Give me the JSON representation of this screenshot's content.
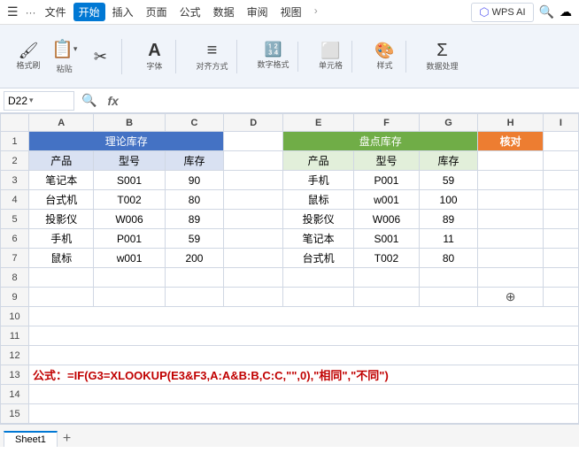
{
  "titlebar": {
    "menus": [
      "文件",
      "开始",
      "插入",
      "页面",
      "公式",
      "数据",
      "审阅",
      "视图"
    ],
    "active_menu": "开始",
    "wps_ai": "WPS AI",
    "dots": "···"
  },
  "ribbon": {
    "groups": [
      {
        "name": "clipboard",
        "items": [
          {
            "label": "格式刷",
            "icon": "🖌"
          },
          {
            "label": "粘贴",
            "icon": "📋"
          },
          {
            "label": "",
            "icon": "✂"
          }
        ]
      },
      {
        "name": "font",
        "items": [
          {
            "label": "字体",
            "icon": "A"
          }
        ]
      },
      {
        "name": "align",
        "items": [
          {
            "label": "对齐方式",
            "icon": "≡"
          }
        ]
      },
      {
        "name": "number",
        "items": [
          {
            "label": "数字格式",
            "icon": "123"
          }
        ]
      },
      {
        "name": "cells",
        "items": [
          {
            "label": "单元格",
            "icon": "⬜"
          }
        ]
      },
      {
        "name": "style",
        "items": [
          {
            "label": "样式",
            "icon": "🎨"
          }
        ]
      },
      {
        "name": "data_processing",
        "items": [
          {
            "label": "数据处理",
            "icon": "Σ"
          }
        ]
      }
    ]
  },
  "formula_bar": {
    "cell_ref": "D22",
    "fx_symbol": "fx"
  },
  "columns": {
    "headers": [
      "",
      "A",
      "B",
      "C",
      "D",
      "E",
      "F",
      "G",
      "H",
      "I"
    ]
  },
  "rows": {
    "row1": {
      "num": "1",
      "a": "理论库存",
      "a_colspan": 3,
      "a_color": "blue",
      "d": "",
      "e": "盘点库存",
      "e_colspan": 3,
      "e_color": "green",
      "h": "核对",
      "h_color": "orange"
    },
    "row2": {
      "num": "2",
      "a": "产品",
      "a_color": "sub-blue",
      "b": "型号",
      "b_color": "sub-blue",
      "c": "库存",
      "c_color": "sub-blue",
      "d": "",
      "e": "产品",
      "e_color": "sub-green",
      "f": "型号",
      "f_color": "sub-green",
      "g": "库存",
      "g_color": "sub-green",
      "h": ""
    },
    "data": [
      {
        "num": "3",
        "a": "笔记本",
        "b": "S001",
        "c": "90",
        "d": "",
        "e": "手机",
        "f": "P001",
        "g": "59",
        "h": ""
      },
      {
        "num": "4",
        "a": "台式机",
        "b": "T002",
        "c": "80",
        "d": "",
        "e": "鼠标",
        "f": "w001",
        "g": "100",
        "h": ""
      },
      {
        "num": "5",
        "a": "投影仪",
        "b": "W006",
        "c": "89",
        "d": "",
        "e": "投影仪",
        "f": "W006",
        "g": "89",
        "h": ""
      },
      {
        "num": "6",
        "a": "手机",
        "b": "P001",
        "c": "59",
        "d": "",
        "e": "笔记本",
        "f": "S001",
        "g": "11",
        "h": ""
      },
      {
        "num": "7",
        "a": "鼠标",
        "b": "w001",
        "c": "200",
        "d": "",
        "e": "台式机",
        "f": "T002",
        "g": "80",
        "h": ""
      }
    ],
    "empty_rows": [
      "8",
      "9",
      "10",
      "11",
      "12"
    ],
    "formula_row": {
      "num": "13",
      "text": "公式：=IF(G3=XLOOKUP(E3&F3,A:A&B:B,C:C,\"\",0),\"相同\",\"不同\")"
    },
    "more_empty": [
      "14",
      "15"
    ]
  },
  "sheet_tab": "Sheet1",
  "crosshair_label": "⊕"
}
